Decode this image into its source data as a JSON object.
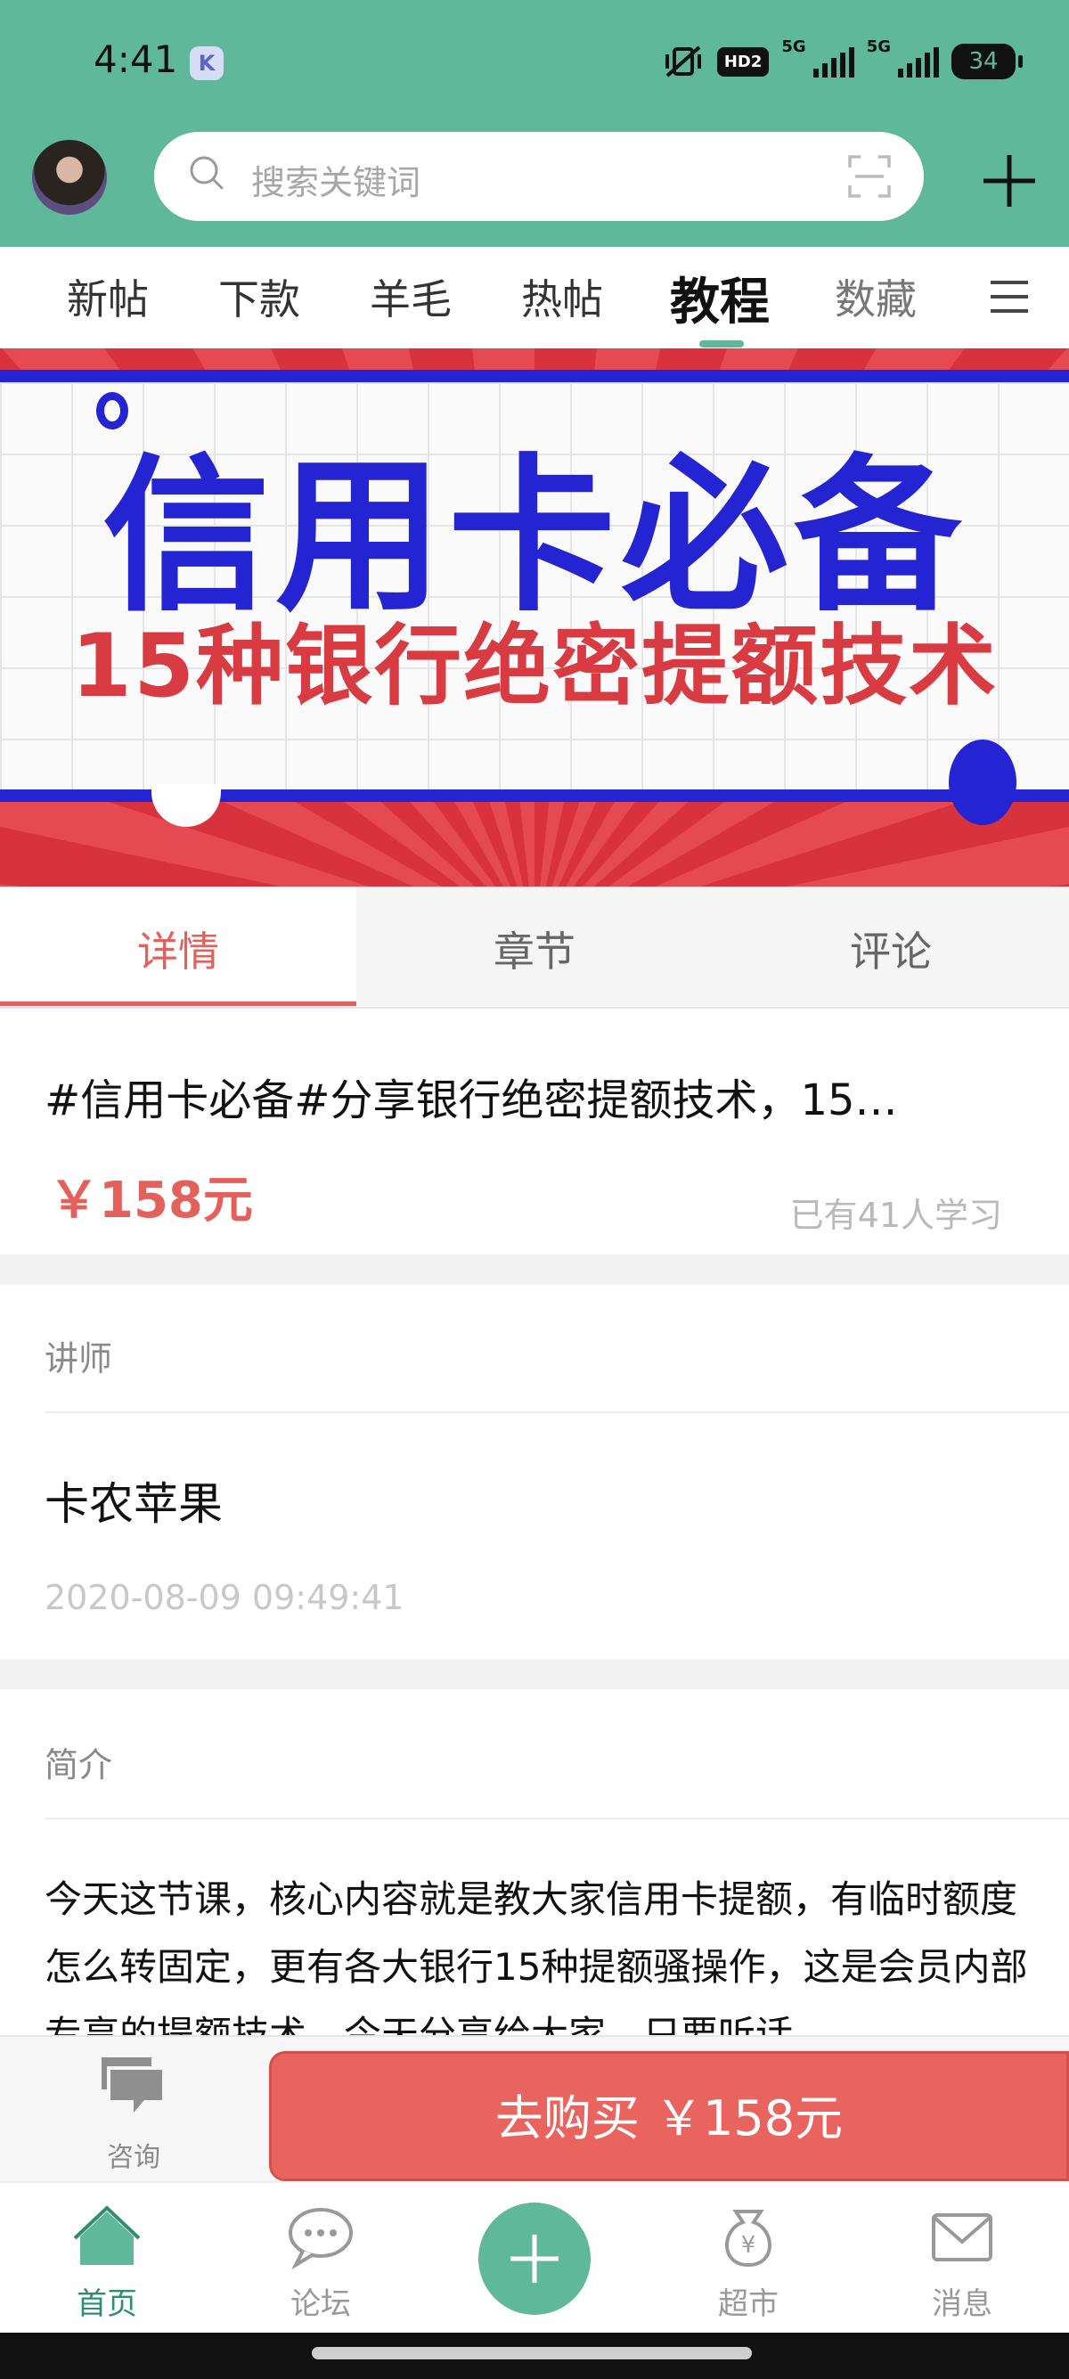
{
  "status_bar": {
    "time": "4:41",
    "app_icon": "K",
    "hd_badge": "HD2",
    "network_1": "5G",
    "network_2": "5G",
    "battery": "34"
  },
  "header": {
    "search_placeholder": "搜索关键词"
  },
  "category_tabs": [
    {
      "label": "新帖",
      "active": false
    },
    {
      "label": "下款",
      "active": false
    },
    {
      "label": "羊毛",
      "active": false
    },
    {
      "label": "热帖",
      "active": false
    },
    {
      "label": "教程",
      "active": true
    },
    {
      "label": "数藏",
      "active": false
    }
  ],
  "banner": {
    "title": "信用卡必备",
    "subtitle": "15种银行绝密提额技术"
  },
  "detail_tabs": [
    {
      "label": "详情",
      "active": true
    },
    {
      "label": "章节",
      "active": false
    },
    {
      "label": "评论",
      "active": false
    }
  ],
  "course": {
    "title": "#信用卡必备#分享银行绝密提额技术，15…",
    "price": "￥158元",
    "learners": "已有41人学习"
  },
  "lecturer": {
    "section_label": "讲师",
    "name": "卡农苹果",
    "date": "2020-08-09 09:49:41"
  },
  "intro": {
    "section_label": "简介",
    "text": "今天这节课，核心内容就是教大家信用卡提额，有临时额度怎么转固定，更有各大银行15种提额骚操作，这是会员内部专享的提额技术，今天分享给大家，只要听话"
  },
  "purchase_bar": {
    "consult_label": "咨询",
    "buy_label": "去购买 ￥158元"
  },
  "bottom_nav": [
    {
      "label": "首页",
      "icon": "home-icon",
      "active": true
    },
    {
      "label": "论坛",
      "icon": "forum-icon",
      "active": false
    },
    {
      "label": "超市",
      "icon": "market-icon",
      "active": false
    },
    {
      "label": "消息",
      "icon": "message-icon",
      "active": false
    }
  ],
  "colors": {
    "brand_green": "#5fb89a",
    "accent_red": "#e4605b",
    "banner_blue": "#2424d2"
  }
}
